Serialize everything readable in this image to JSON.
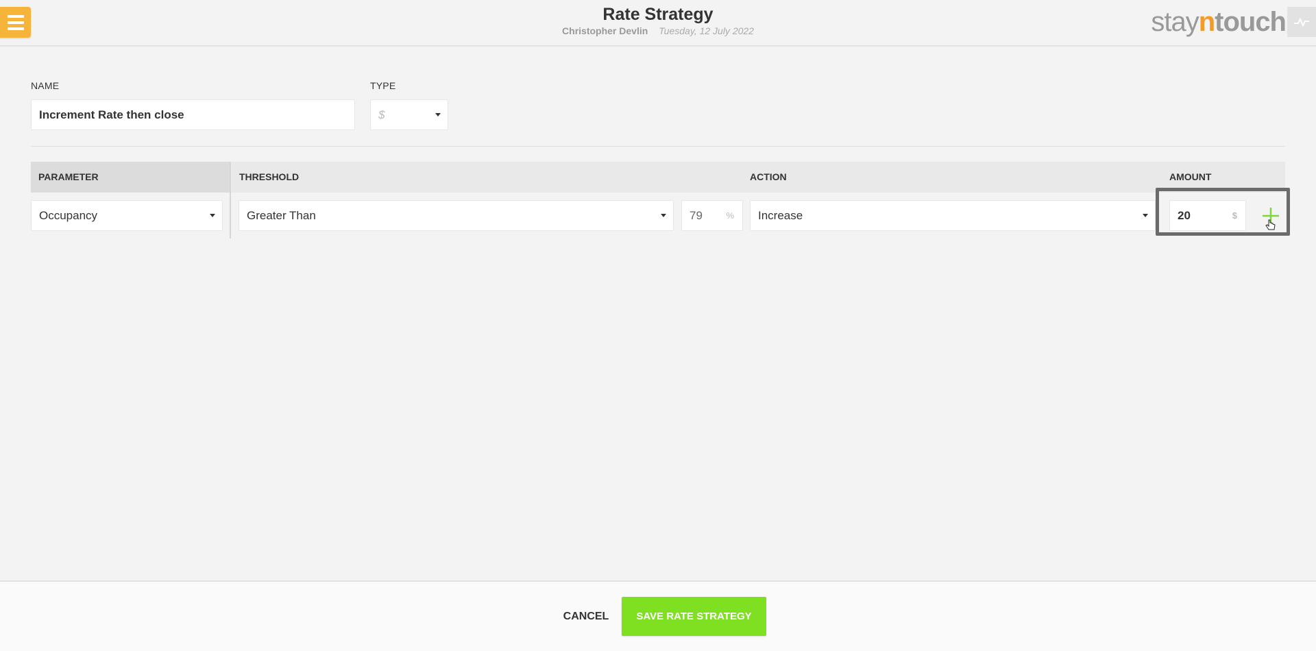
{
  "header": {
    "title": "Rate Strategy",
    "user": "Christopher Devlin",
    "date": "Tuesday, 12 July 2022",
    "logo_part1": "stay",
    "logo_part2": "n",
    "logo_part3": "touch"
  },
  "form": {
    "name_label": "NAME",
    "name_value": "Increment Rate then close",
    "type_label": "TYPE",
    "type_value": "$"
  },
  "table": {
    "headers": {
      "parameter": "PARAMETER",
      "threshold": "THRESHOLD",
      "action": "ACTION",
      "amount": "AMOUNT"
    },
    "row": {
      "parameter": "Occupancy",
      "threshold_operator": "Greater Than",
      "threshold_value": "79",
      "threshold_unit": "%",
      "action": "Increase",
      "amount_value": "20",
      "amount_unit": "$"
    }
  },
  "footer": {
    "cancel_label": "CANCEL",
    "save_label": "SAVE RATE STRATEGY"
  },
  "colors": {
    "menu": "#f6b53a",
    "save": "#7fe022",
    "plus": "#7fd63a",
    "logo_accent": "#f39a2b"
  },
  "icons": [
    "menu-icon",
    "activity-icon",
    "plus-icon",
    "hand-cursor-icon",
    "caret-down-icon"
  ]
}
